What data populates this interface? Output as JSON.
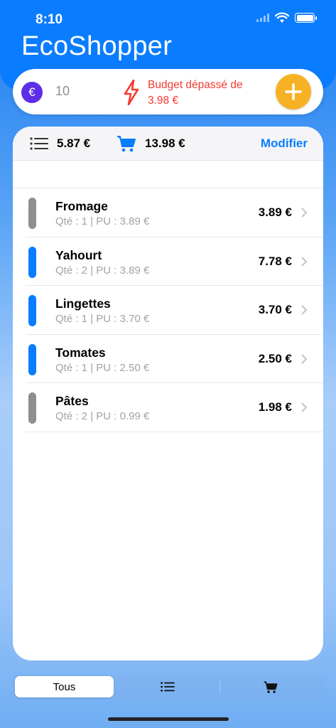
{
  "status": {
    "time": "8:10"
  },
  "app": {
    "title": "EcoShopper"
  },
  "budget": {
    "currency_symbol": "€",
    "value": "10",
    "warning_line1": "Budget dépassé de",
    "warning_line2": "3.98 €",
    "warning_color": "#f23b30",
    "add_icon": "plus-icon"
  },
  "totals": {
    "list_total": "5.87 €",
    "cart_total": "13.98 €",
    "modify_label": "Modifier"
  },
  "items": [
    {
      "name": "Fromage",
      "detail": "Qté : 1  |  PU : 3.89 €",
      "price": "3.89 €",
      "bar_color": "#8e8e93"
    },
    {
      "name": "Yahourt",
      "detail": "Qté : 2  |  PU : 3.89 €",
      "price": "7.78 €",
      "bar_color": "#0a7cff"
    },
    {
      "name": "Lingettes",
      "detail": "Qté : 1  |  PU : 3.70 €",
      "price": "3.70 €",
      "bar_color": "#0a7cff"
    },
    {
      "name": "Tomates",
      "detail": "Qté : 1  |  PU : 2.50 €",
      "price": "2.50 €",
      "bar_color": "#0a7cff"
    },
    {
      "name": "Pâtes",
      "detail": "Qté : 2  |  PU : 0.99 €",
      "price": "1.98 €",
      "bar_color": "#8e8e93"
    }
  ],
  "tabs": {
    "all_label": "Tous",
    "list_icon": "list-icon",
    "cart_icon": "cart-icon"
  },
  "colors": {
    "accent": "#0a7cff",
    "add_button": "#f6b224",
    "euro_badge": "#5d2ee8"
  }
}
